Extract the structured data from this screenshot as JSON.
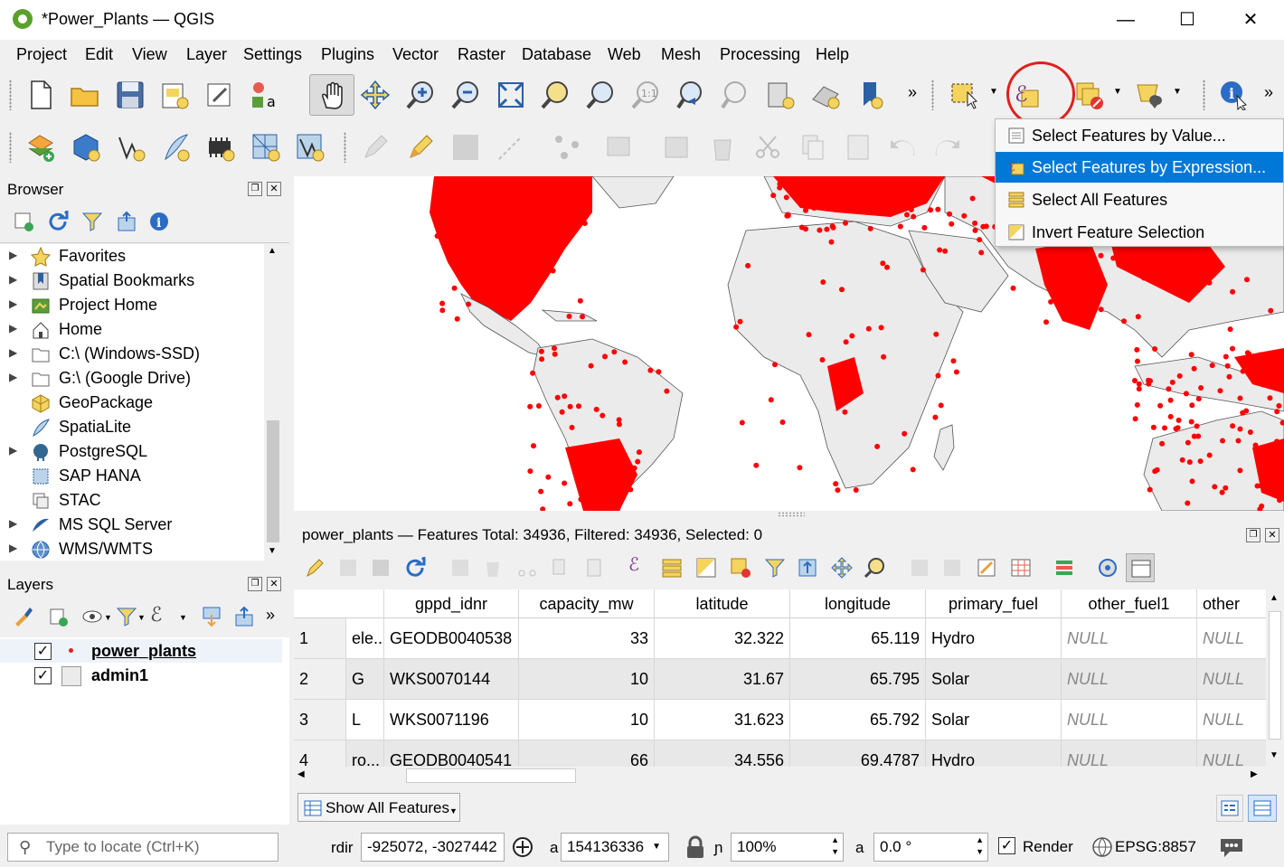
{
  "window": {
    "title": "*Power_Plants — QGIS"
  },
  "colors": {
    "point": "#ff0000",
    "selection": "#0078d7",
    "highlight_circle": "#e0201c",
    "land": "#ebebeb",
    "border": "#555555"
  },
  "menubar": [
    "Project",
    "Edit",
    "View",
    "Layer",
    "Settings",
    "Plugins",
    "Vector",
    "Raster",
    "Database",
    "Web",
    "Mesh",
    "Processing",
    "Help"
  ],
  "select_menu": {
    "items": [
      {
        "label": "Select Features by Value...",
        "icon": "select-by-value-icon",
        "highlighted": false
      },
      {
        "label": "Select Features by Expression...",
        "icon": "select-by-expression-icon",
        "highlighted": true
      },
      {
        "label": "Select All Features",
        "icon": "select-all-icon",
        "highlighted": false
      },
      {
        "label": "Invert Feature Selection",
        "icon": "invert-selection-icon",
        "highlighted": false
      }
    ]
  },
  "browser": {
    "title": "Browser",
    "items": [
      {
        "label": "Favorites",
        "icon": "star-icon",
        "expandable": true
      },
      {
        "label": "Spatial Bookmarks",
        "icon": "bookmark-icon",
        "expandable": true
      },
      {
        "label": "Project Home",
        "icon": "project-home-icon",
        "expandable": true
      },
      {
        "label": "Home",
        "icon": "home-icon",
        "expandable": true
      },
      {
        "label": "C:\\ (Windows-SSD)",
        "icon": "folder-icon",
        "expandable": true
      },
      {
        "label": "G:\\ (Google Drive)",
        "icon": "folder-icon",
        "expandable": true
      },
      {
        "label": "GeoPackage",
        "icon": "geopackage-icon",
        "expandable": false
      },
      {
        "label": "SpatiaLite",
        "icon": "spatialite-icon",
        "expandable": false
      },
      {
        "label": "PostgreSQL",
        "icon": "postgresql-icon",
        "expandable": true
      },
      {
        "label": "SAP HANA",
        "icon": "sap-hana-icon",
        "expandable": false
      },
      {
        "label": "STAC",
        "icon": "stac-icon",
        "expandable": false
      },
      {
        "label": "MS SQL Server",
        "icon": "mssql-icon",
        "expandable": true
      },
      {
        "label": "WMS/WMTS",
        "icon": "wms-icon",
        "expandable": true
      }
    ]
  },
  "layers": {
    "title": "Layers",
    "items": [
      {
        "name": "power_plants",
        "checked": true,
        "active": true
      },
      {
        "name": "admin1",
        "checked": true,
        "active": false
      }
    ]
  },
  "attribute_table": {
    "title": "power_plants — Features Total: 34936, Filtered: 34936, Selected: 0",
    "columns": [
      "",
      "gppd_idnr",
      "capacity_mw",
      "latitude",
      "longitude",
      "primary_fuel",
      "other_fuel1",
      "other"
    ],
    "rows": [
      {
        "n": "1",
        "name": "ele...",
        "id": "GEODB0040538",
        "cap": "33",
        "lat": "32.322",
        "lon": "65.119",
        "fuel": "Hydro",
        "o1": "NULL",
        "o2": "NULL"
      },
      {
        "n": "2",
        "name": "G",
        "id": "WKS0070144",
        "cap": "10",
        "lat": "31.67",
        "lon": "65.795",
        "fuel": "Solar",
        "o1": "NULL",
        "o2": "NULL"
      },
      {
        "n": "3",
        "name": "L",
        "id": "WKS0071196",
        "cap": "10",
        "lat": "31.623",
        "lon": "65.792",
        "fuel": "Solar",
        "o1": "NULL",
        "o2": "NULL"
      },
      {
        "n": "4",
        "name": "ro...",
        "id": "GEODB0040541",
        "cap": "66",
        "lat": "34.556",
        "lon": "69.4787",
        "fuel": "Hydro",
        "o1": "NULL",
        "o2": "NULL"
      }
    ],
    "show_all": "Show All Features"
  },
  "statusbar": {
    "locate_placeholder": "Type to locate (Ctrl+K)",
    "coord_label": "rdir",
    "coordinate": "-925072, -3027442",
    "scale_label": "a",
    "scale": "154136336",
    "magnifier_label": "ɲ",
    "magnifier": "100%",
    "rotation_label": "a",
    "rotation": "0.0 °",
    "render": "Render",
    "crs": "EPSG:8857"
  }
}
